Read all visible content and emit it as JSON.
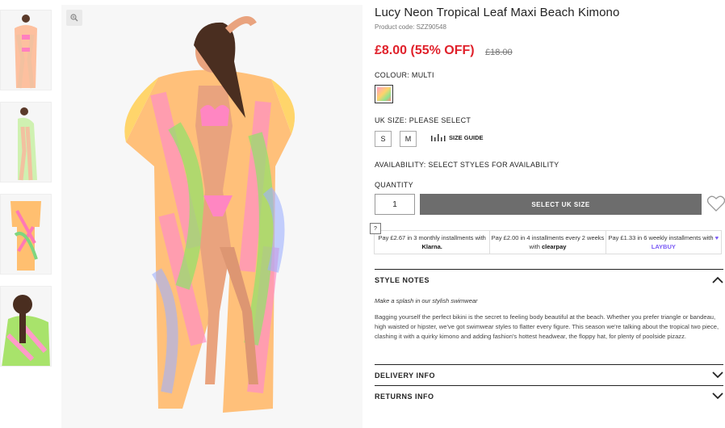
{
  "product": {
    "title": "Lucy Neon Tropical Leaf Maxi Beach Kimono",
    "code": "Product code: SZZ90548",
    "price": "£8.00 (55% OFF)",
    "old_price": "£18.00"
  },
  "colour": {
    "label": "COLOUR:",
    "value": "MULTI"
  },
  "size": {
    "label": "UK SIZE:",
    "value": "PLEASE SELECT",
    "options": [
      "S",
      "M"
    ],
    "guide_label": "SIZE GUIDE"
  },
  "availability": {
    "label": "AVAILABILITY:",
    "value": "SELECT STYLES FOR AVAILABILITY"
  },
  "quantity": {
    "label": "QUANTITY",
    "value": "1"
  },
  "add_button": "SELECT UK SIZE",
  "payment": {
    "help": "?",
    "klarna_text": "Pay £2.67 in 3 monthly installments with",
    "klarna_brand": "Klarna.",
    "clearpay_text": "Pay £2.00 in 4 installments every 2 weeks with",
    "clearpay_brand": "clearpay",
    "laybuy_text": "Pay £1.33 in 6 weekly installments with",
    "laybuy_brand": "LAYBUY"
  },
  "style_notes": {
    "heading": "STYLE NOTES",
    "intro": "Make a splash in our stylish swimwear",
    "body": "Bagging yourself the perfect bikini is the secret to feeling body beautiful at the beach. Whether you prefer triangle or bandeau, high waisted or hipster, we've got swimwear styles to flatter every figure. This season we're talking about the tropical two piece, clashing it with a quirky kimono and adding fashion's hottest headwear, the floppy hat, for plenty of poolside pizazz."
  },
  "delivery": {
    "heading": "DELIVERY INFO"
  },
  "returns": {
    "heading": "RETURNS INFO"
  },
  "colors": {
    "price_red": "#e0212b",
    "button_grey": "#6d6d6d"
  }
}
